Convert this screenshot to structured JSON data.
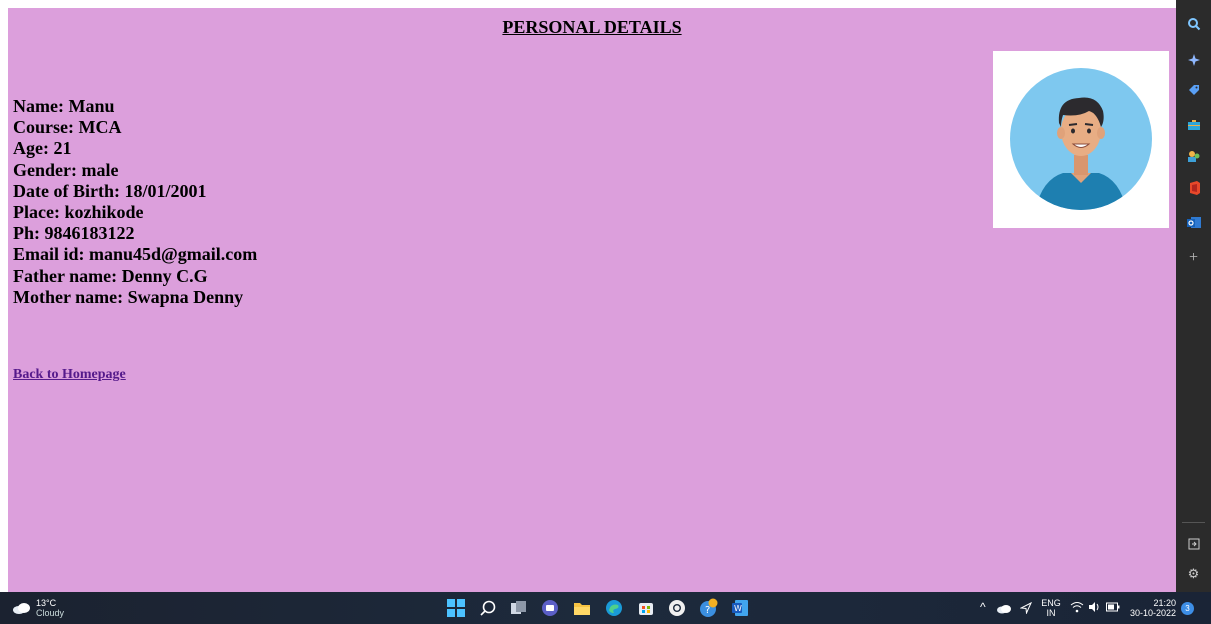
{
  "page": {
    "title": "PERSONAL DETAILS",
    "details": [
      "Name: Manu",
      "Course: MCA",
      "Age: 21",
      "Gender: male",
      "Date of Birth: 18/01/2001",
      "Place: kozhikode",
      "Ph: 9846183122",
      "Email id: manu45d@gmail.com",
      "Father name: Denny C.G",
      "Mother name: Swapna Denny"
    ],
    "back_link": "Back to Homepage"
  },
  "colors": {
    "page_background": "#dc9fdc",
    "link": "#551a8b",
    "sidebar": "#2b2b2b",
    "taskbar": "#1d2a3c",
    "avatar_circle": "#7ec8ef",
    "shirt": "#1e7fb0"
  },
  "sidebar": {
    "icons": [
      "search-icon",
      "copilot-sparkle-icon",
      "shopping-tag-icon",
      "briefcase-icon",
      "people-icon",
      "office-icon",
      "outlook-icon",
      "add-icon",
      "split-screen-icon",
      "settings-icon"
    ]
  },
  "taskbar": {
    "weather": {
      "temp": "13°C",
      "condition": "Cloudy"
    },
    "apps": [
      "windows-start-icon",
      "search-icon",
      "task-view-icon",
      "teams-chat-icon",
      "file-explorer-icon",
      "edge-icon",
      "store-icon",
      "chrome-icon",
      "app-icon",
      "word-icon"
    ],
    "tray": {
      "lang_top": "ENG",
      "lang_bottom": "IN",
      "time": "21:20",
      "date": "30-10-2022",
      "notifications": "3"
    }
  }
}
